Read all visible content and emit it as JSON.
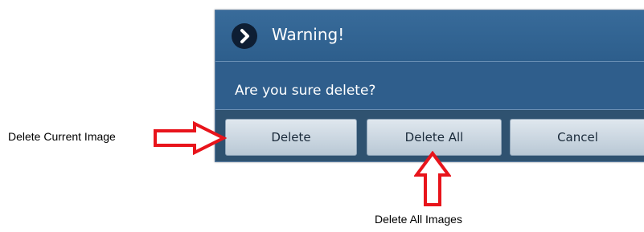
{
  "dialog": {
    "title": "Warning!",
    "message": "Are you sure delete?",
    "icon": "chevron-right-icon",
    "buttons": {
      "delete": "Delete",
      "delete_all": "Delete All",
      "cancel": "Cancel"
    }
  },
  "annotations": {
    "delete_current": "Delete Current Image",
    "delete_all": "Delete All Images"
  },
  "colors": {
    "dialog_bg": "#2f5e8c",
    "arrow_red": "#e8141b"
  }
}
